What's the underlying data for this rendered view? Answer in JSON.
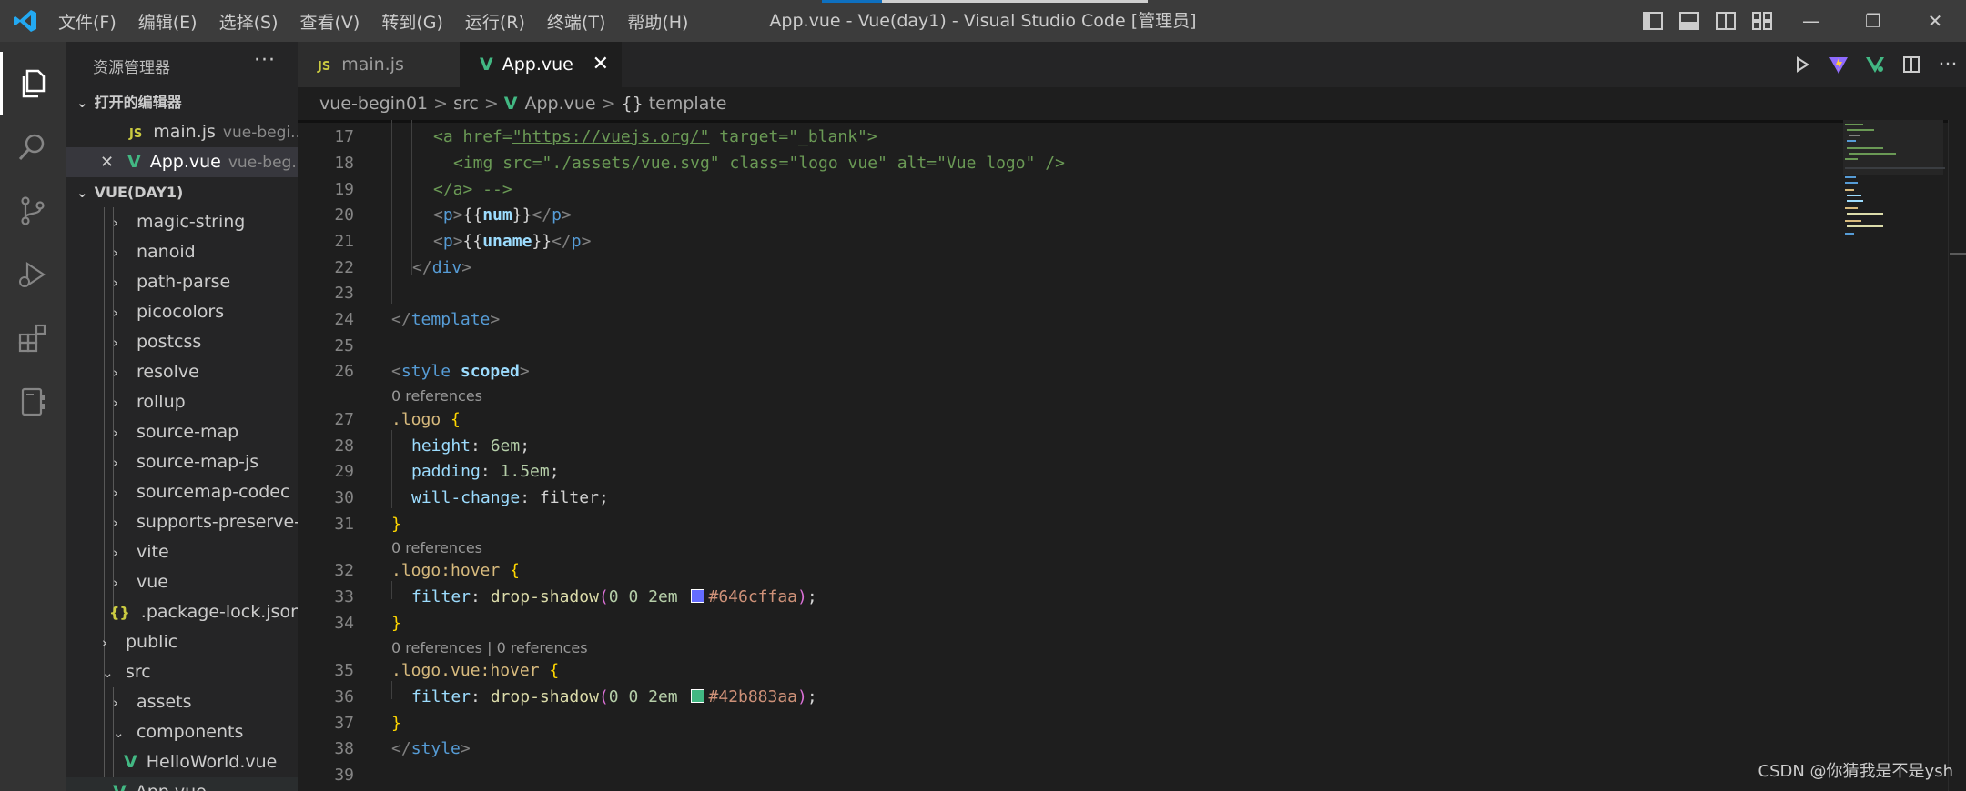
{
  "titlebar": {
    "menu": [
      "文件(F)",
      "编辑(E)",
      "选择(S)",
      "查看(V)",
      "转到(G)",
      "运行(R)",
      "终端(T)",
      "帮助(H)"
    ],
    "window_title": "App.vue - Vue(day1) - Visual Studio Code [管理员]",
    "buttons": {
      "minimize": "—",
      "restore": "❐",
      "close": "✕"
    }
  },
  "activitybar": {
    "icons": [
      "explorer-icon",
      "search-icon",
      "source-control-icon",
      "run-debug-icon",
      "extensions-icon",
      "remote-icon"
    ]
  },
  "sidebar": {
    "title": "资源管理器",
    "more": "···",
    "open_editors": {
      "label": "打开的编辑器",
      "items": [
        {
          "icon": "JS",
          "name": "main.js",
          "desc": "vue-begi..."
        },
        {
          "icon": "V",
          "name": "App.vue",
          "desc": "vue-beg...",
          "close": "✕"
        }
      ]
    },
    "workspace": {
      "label": "VUE(DAY1)",
      "items": [
        {
          "name": "magic-string",
          "chev": "›"
        },
        {
          "name": "nanoid",
          "chev": "›"
        },
        {
          "name": "path-parse",
          "chev": "›"
        },
        {
          "name": "picocolors",
          "chev": "›"
        },
        {
          "name": "postcss",
          "chev": "›"
        },
        {
          "name": "resolve",
          "chev": "›"
        },
        {
          "name": "rollup",
          "chev": "›"
        },
        {
          "name": "source-map",
          "chev": "›"
        },
        {
          "name": "source-map-js",
          "chev": "›"
        },
        {
          "name": "sourcemap-codec",
          "chev": "›"
        },
        {
          "name": "supports-preserve-...",
          "chev": "›"
        },
        {
          "name": "vite",
          "chev": "›"
        },
        {
          "name": "vue",
          "chev": "›"
        },
        {
          "name": ".package-lock.json",
          "icon": "{}"
        },
        {
          "name": "public",
          "chev": "›"
        },
        {
          "name": "src",
          "chev": "⌄"
        },
        {
          "name": "assets",
          "chev": "›"
        },
        {
          "name": "components",
          "chev": "⌄"
        },
        {
          "name": "HelloWorld.vue",
          "icon": "V"
        },
        {
          "name": "App.vue",
          "icon": "V"
        }
      ]
    }
  },
  "tabs": [
    {
      "badge": "JS",
      "label": "main.js"
    },
    {
      "badge": "V",
      "label": "App.vue",
      "close": "✕"
    }
  ],
  "breadcrumb": {
    "root": "vue-begin01",
    "folder": "src",
    "file": "App.vue",
    "symbol_icon": "{}",
    "symbol": "template",
    "sep": ">"
  },
  "editor": {
    "line_numbers": [
      "17",
      "18",
      "19",
      "20",
      "21",
      "22",
      "23",
      "24",
      "25",
      "26",
      "27",
      "28",
      "29",
      "30",
      "31",
      "32",
      "33",
      "34",
      "35",
      "36",
      "37",
      "38",
      "39"
    ],
    "codelens": {
      "a": "0 references",
      "b": "0 references",
      "c": "0 references | 0 references"
    },
    "tokens": {
      "l17": [
        "<a ",
        "href",
        "=",
        "\"https://vuejs.org/\"",
        " target",
        "=",
        "\"_blank\"",
        ">"
      ],
      "l18": [
        "<img ",
        "src",
        "=",
        "\"./assets/vue.svg\"",
        " class",
        "=",
        "\"logo vue\"",
        " alt",
        "=",
        "\"Vue logo\"",
        " />"
      ],
      "l19": [
        "</a> -->"
      ],
      "l20": [
        "<",
        "p",
        ">",
        "{{",
        "num",
        "}}",
        "</",
        "p",
        ">"
      ],
      "l21": [
        "<",
        "p",
        ">",
        "{{",
        "uname",
        "}}",
        "</",
        "p",
        ">"
      ],
      "l22": [
        "</",
        "div",
        ">"
      ],
      "l24": [
        "</",
        "template",
        ">"
      ],
      "l26": [
        "<",
        "style",
        " ",
        "scoped",
        ">"
      ],
      "l27": [
        ".logo",
        " ",
        "{"
      ],
      "l28": [
        "height",
        ": ",
        "6em",
        ";"
      ],
      "l29": [
        "padding",
        ": ",
        "1.5em",
        ";"
      ],
      "l30": [
        "will-change",
        ": ",
        "filter",
        ";"
      ],
      "l31": [
        "}"
      ],
      "l32": [
        ".logo:hover",
        " ",
        "{"
      ],
      "l33": [
        "filter",
        ": ",
        "drop-shadow",
        "(",
        "0 0 2em ",
        "#646cffaa",
        ")",
        ";"
      ],
      "l34": [
        "}"
      ],
      "l35": [
        ".logo.vue:hover",
        " ",
        "{"
      ],
      "l36": [
        "filter",
        ": ",
        "drop-shadow",
        "(",
        "0 0 2em ",
        "#42b883aa",
        ")",
        ";"
      ],
      "l37": [
        "}"
      ],
      "l38": [
        "</",
        "style",
        ">"
      ]
    },
    "swatches": {
      "purple": "#646cff",
      "green": "#42b883"
    }
  },
  "watermark": "CSDN @你猜我是不是ysh",
  "colors": {
    "vue_green": "#42b883",
    "js_yellow": "#cbcb41",
    "accent_blue": "#0e70c0"
  }
}
